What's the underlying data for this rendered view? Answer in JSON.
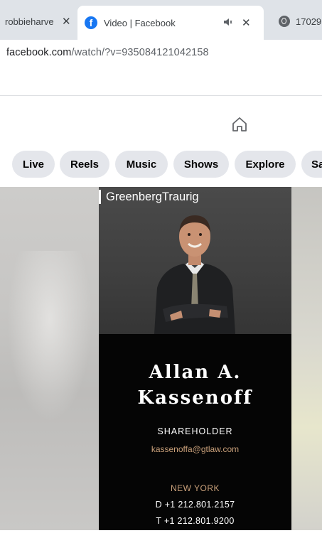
{
  "browser": {
    "tabs": [
      {
        "title": "robbieharve",
        "icon": "tab-favicon-hidden"
      },
      {
        "title": "Video | Facebook",
        "icon": "facebook-icon",
        "active": true
      },
      {
        "title": "17029",
        "icon": "globe-icon"
      }
    ],
    "close_glyph": "✕",
    "mute_glyph": "🔈",
    "url_host": "facebook.com",
    "url_path": "/watch/?v=935084121042158"
  },
  "facebook": {
    "nav_icon": "home-icon",
    "chips": [
      "Live",
      "Reels",
      "Music",
      "Shows",
      "Explore",
      "Saved"
    ],
    "brand_color": "#1877f2"
  },
  "video": {
    "logo": "GreenbergTraurig",
    "name_line1": "Allan A.",
    "name_line2": "Kassenoff",
    "title": "SHAREHOLDER",
    "email": "kassenoffa@gtlaw.com",
    "city": "NEW YORK",
    "phone_direct": "D +1 212.801.2157",
    "phone_main": "T +1 212.801.9200",
    "accent_color": "#c9a07a"
  }
}
